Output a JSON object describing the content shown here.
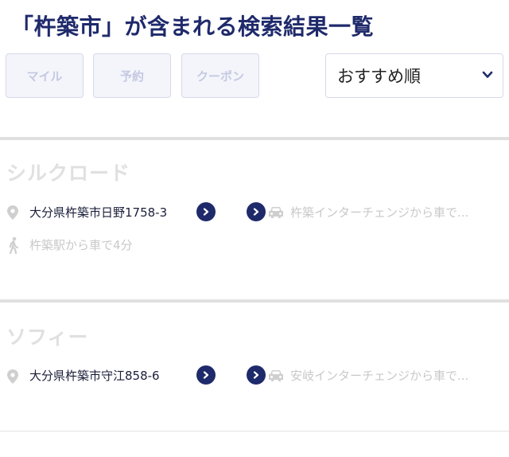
{
  "page": {
    "title": "「杵築市」が含まれる検索結果一覧"
  },
  "filters": {
    "mile_label": "マイル",
    "reserve_label": "予約",
    "coupon_label": "クーポン"
  },
  "sort": {
    "selected": "おすすめ順",
    "icon": "chevron-down-icon"
  },
  "results": [
    {
      "name": "シルクロード",
      "address": "大分県杵築市日野1758-3",
      "car_access": "杵築インターチェンジから車で...",
      "walk_access": "杵築駅から車で4分"
    },
    {
      "name": "ソフィー",
      "address": "大分県杵築市守江858-6",
      "car_access": "安岐インターチェンジから車で..."
    }
  ],
  "colors": {
    "accent": "#1f2a6b",
    "muted": "#c9c9c9",
    "filter_bg": "#f4f5fb"
  }
}
